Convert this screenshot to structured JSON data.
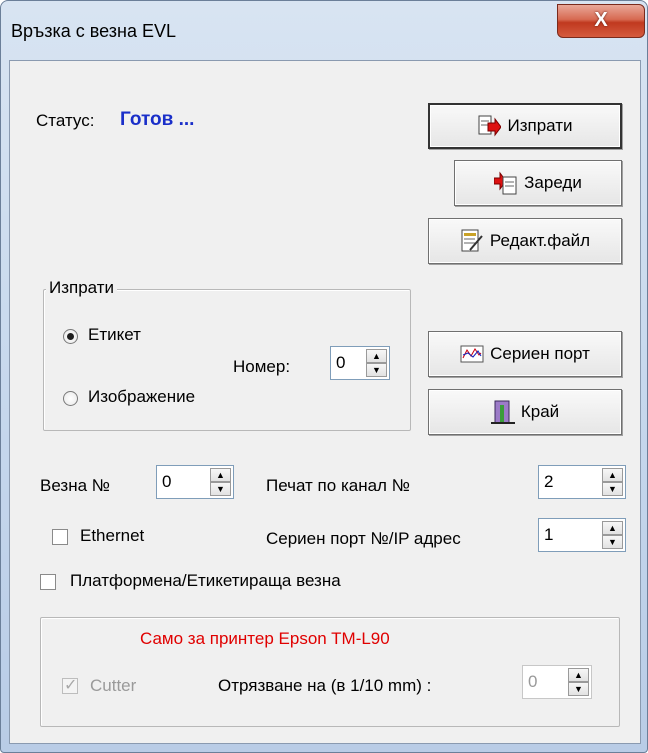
{
  "window": {
    "title": "Връзка с везна EVL",
    "close_label": "X"
  },
  "status": {
    "label": "Статус:",
    "value": "Готов ..."
  },
  "buttons": {
    "send": "Изпрати",
    "load": "Зареди",
    "edit_file": "Редакт.файл",
    "serial_port": "Сериен порт",
    "exit": "Край"
  },
  "send_group": {
    "title": "Изпрати",
    "option_label": "Етикет",
    "option_image": "Изображение",
    "selected": "Етикет",
    "number_label": "Номер:",
    "number_value": "0"
  },
  "scale": {
    "label": "Везна №",
    "value": "0",
    "ethernet_label": "Ethernet",
    "ethernet_checked": false,
    "platform_label": "Платформена/Етикетираща везна",
    "platform_checked": false
  },
  "print_channel": {
    "label": "Печат по канал №",
    "value": "2"
  },
  "serial_ip": {
    "label": "Сериен порт №/IP адрес",
    "value": "1"
  },
  "epson": {
    "caption": "Само за принтер Epson TM-L90",
    "cutter_label": "Cutter",
    "cutter_checked": true,
    "cut_label": "Отрязване на (в 1/10 mm) :",
    "cut_value": "0"
  },
  "colors": {
    "status": "#1a2fc9",
    "epson_caption": "#e00000",
    "close_button": "#c0391f"
  },
  "icons": {
    "send": "send-document-icon",
    "load": "load-document-icon",
    "edit_file": "edit-file-icon",
    "serial_port": "serial-port-icon",
    "exit": "exit-door-icon"
  }
}
